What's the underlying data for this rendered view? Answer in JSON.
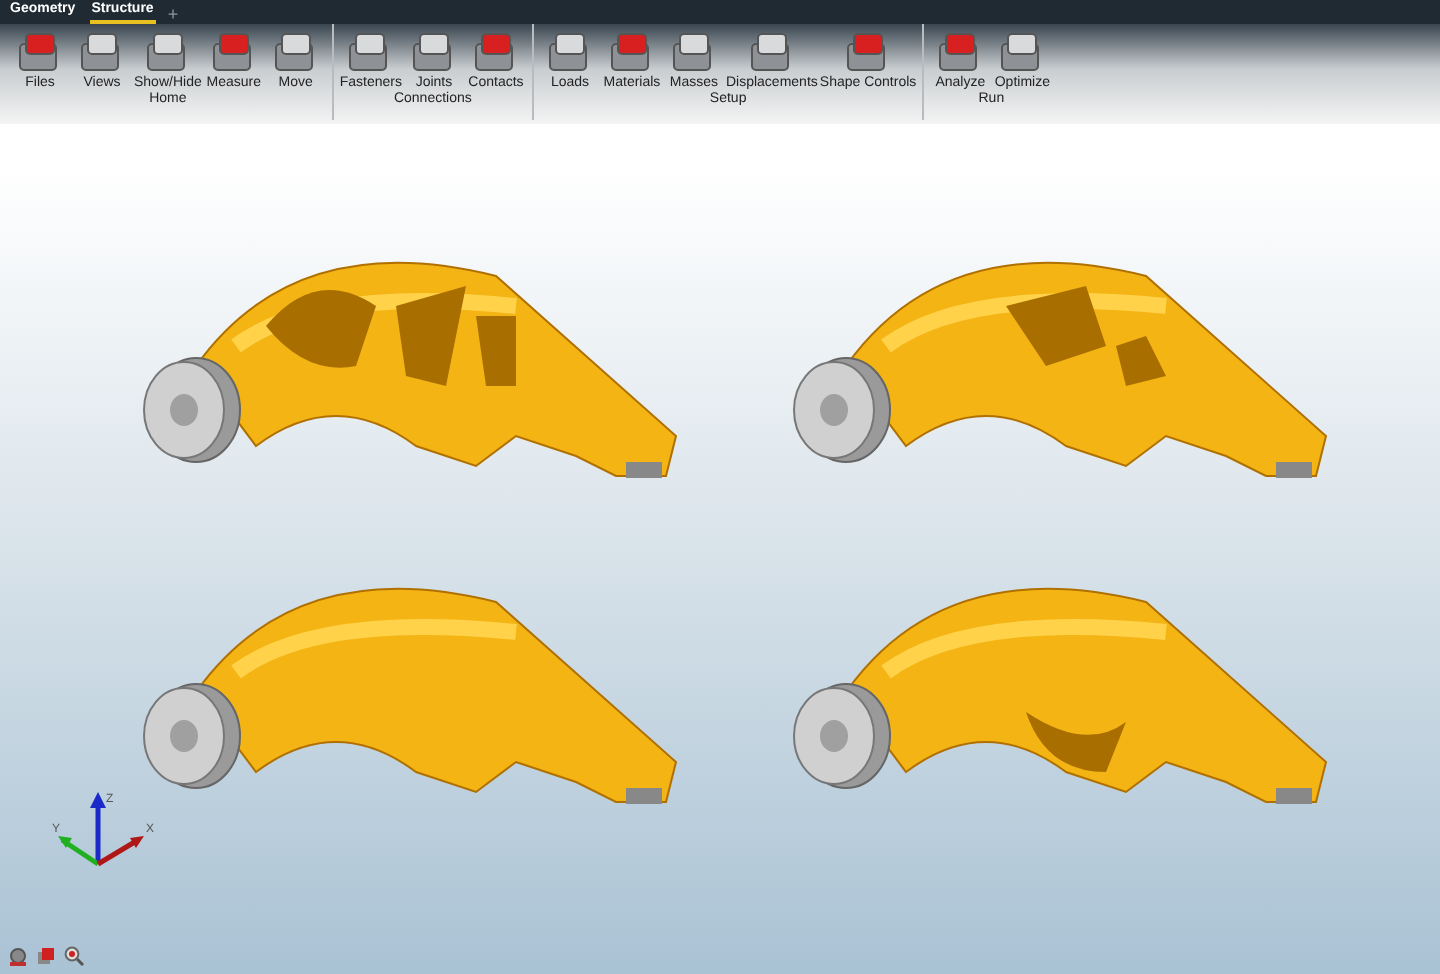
{
  "tabs": [
    {
      "label": "Geometry",
      "selected": false
    },
    {
      "label": "Structure",
      "selected": true
    }
  ],
  "add_tab": "+",
  "ribbon_groups": [
    {
      "label": "Home",
      "tools": [
        "Files",
        "Views",
        "Show/Hide",
        "Measure",
        "Move"
      ]
    },
    {
      "label": "Connections",
      "tools": [
        "Fasteners",
        "Joints",
        "Contacts"
      ]
    },
    {
      "label": "Setup",
      "tools": [
        "Loads",
        "Materials",
        "Masses",
        "Displacements",
        "Shape Controls"
      ]
    },
    {
      "label": "Run",
      "tools": [
        "Analyze",
        "Optimize"
      ]
    }
  ],
  "axes": {
    "x": "X",
    "y": "Y",
    "z": "Z"
  }
}
